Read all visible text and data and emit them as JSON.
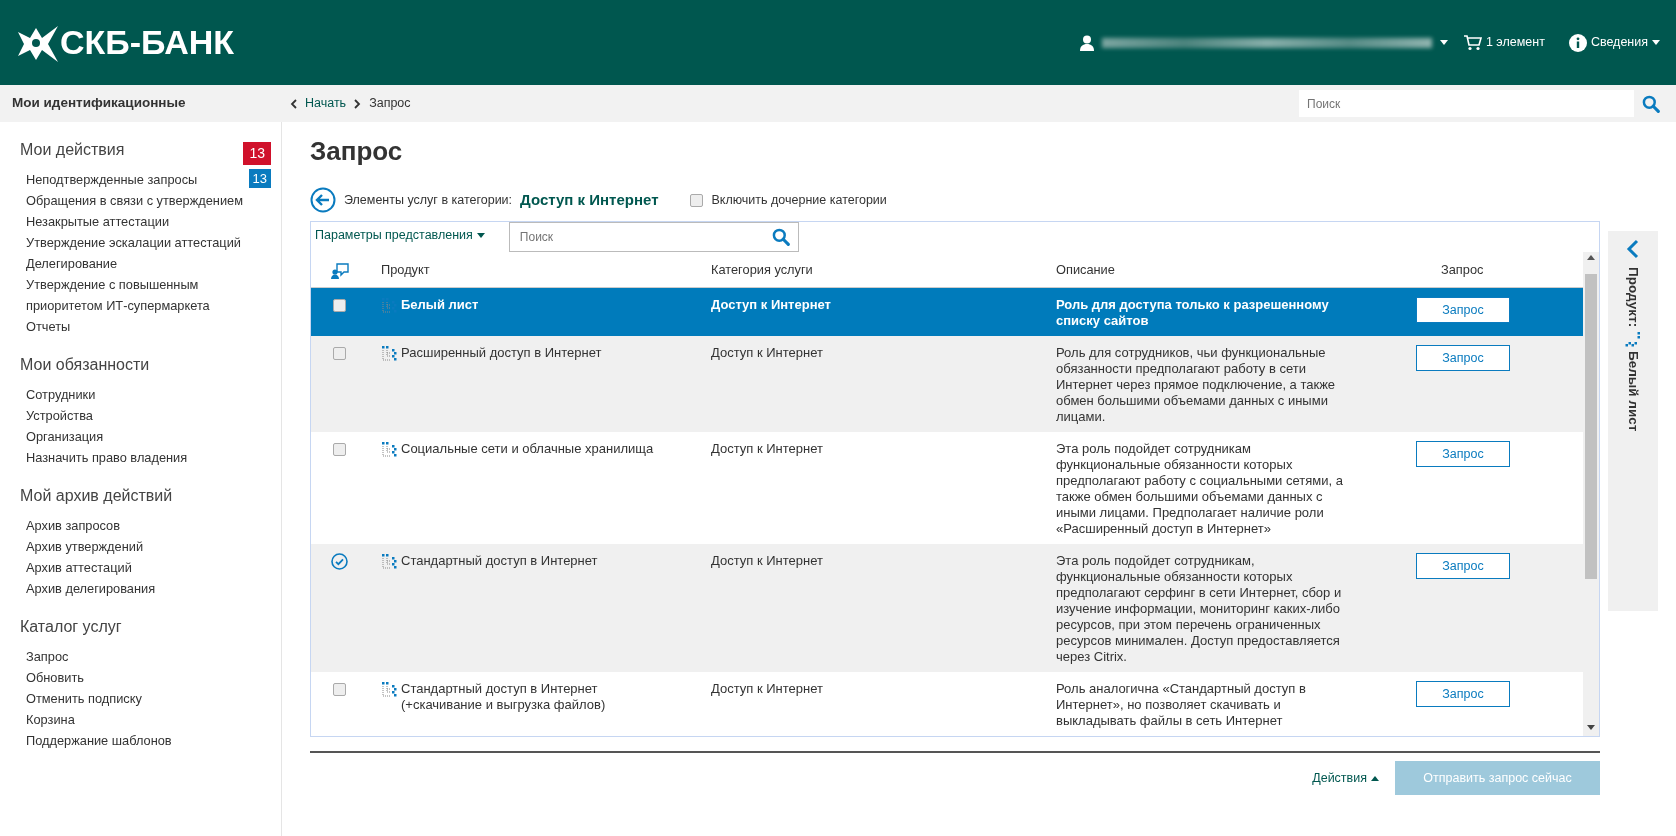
{
  "header": {
    "logo": "СКБ-БАНК",
    "cart": "1 элемент",
    "info_menu": "Сведения"
  },
  "topbar": {
    "section_title": "Мои идентификационные",
    "breadcrumbs": [
      "Начать",
      "Запрос"
    ],
    "search": {
      "placeholder": "Поиск"
    }
  },
  "sidebar": {
    "groups": [
      {
        "title": "Мои действия",
        "badge": "13",
        "items": [
          {
            "label": "Неподтвержденные запросы",
            "badge": "13"
          },
          {
            "label": "Обращения в связи с утверждением"
          },
          {
            "label": "Незакрытые аттестации"
          },
          {
            "label": "Утверждение эскалации аттестаций"
          },
          {
            "label": "Делегирование"
          },
          {
            "label": "Утверждение с повышенным приоритетом ИТ-супермаркета"
          },
          {
            "label": "Отчеты"
          }
        ]
      },
      {
        "title": "Мои обязанности",
        "items": [
          {
            "label": "Сотрудники"
          },
          {
            "label": "Устройства"
          },
          {
            "label": "Организация"
          },
          {
            "label": "Назначить право владения"
          }
        ]
      },
      {
        "title": "Мой архив действий",
        "items": [
          {
            "label": "Архив запросов"
          },
          {
            "label": "Архив утверждений"
          },
          {
            "label": "Архив аттестаций"
          },
          {
            "label": "Архив делегирования"
          }
        ]
      },
      {
        "title": "Каталог услуг",
        "items": [
          {
            "label": "Запрос"
          },
          {
            "label": "Обновить"
          },
          {
            "label": "Отменить подписку"
          },
          {
            "label": "Корзина"
          },
          {
            "label": "Поддержание шаблонов"
          }
        ]
      }
    ]
  },
  "page": {
    "title": "Запрос",
    "category_label": "Элементы услуг в категории:",
    "category": "Доступ к Интернет",
    "include_children": {
      "label": "Включить дочерние категории",
      "checked": false
    }
  },
  "table": {
    "view_options": "Параметры представления",
    "search": {
      "placeholder": "Поиск"
    },
    "columns": [
      "Продукт",
      "Категория услуги",
      "Описание",
      "Запрос"
    ],
    "rows": [
      {
        "kind": "checkbox",
        "checked": false,
        "selected": true,
        "product": "Белый лист",
        "category": "Доступ к Интернет",
        "description": "Роль для доступа только к разрешенному списку сайтов",
        "button": "Запрос"
      },
      {
        "kind": "checkbox",
        "checked": false,
        "selected": false,
        "product": "Расширенный доступ в Интернет",
        "category": "Доступ к Интернет",
        "description": "Роль для сотрудников, чьи функциональные обязанности предполагают работу в сети Интернет через прямое подключение, а также обмен большими объемами данных с иными лицами.",
        "button": "Запрос"
      },
      {
        "kind": "checkbox",
        "checked": false,
        "selected": false,
        "product": "Социальные сети и облачные хранилища",
        "category": "Доступ к Интернет",
        "description": "Эта роль подойдет сотрудникам функциональные обязанности которых предполагают работу с социальными сетями, а также обмен большими объемами данных с иными лицами. Предполагает наличие роли «Расширенный доступ в Интернет»",
        "button": "Запрос"
      },
      {
        "kind": "added",
        "selected": false,
        "product": "Стандартный доступ в Интернет",
        "category": "Доступ к Интернет",
        "description": "Эта роль подойдет сотрудникам, функциональные обязанности которых предполагают серфинг в сети Интернет, сбор и изучение информации, мониторинг каких-либо ресурсов, при этом перечень ограниченных ресурсов минимален. Доступ предоставляется через Citrix.",
        "button": "Запрос"
      },
      {
        "kind": "checkbox",
        "checked": false,
        "selected": false,
        "product": "Стандартный доступ в Интернет\n(+скачивание и выгрузка файлов)",
        "category": "Доступ к Интернет",
        "description": "Роль аналогична «Стандартный доступ в Интернет», но позволяет скачивать и выкладывать файлы в сеть Интернет",
        "button": "Запрос"
      }
    ]
  },
  "details_panel": {
    "label": "Продукт:",
    "value": "Белый лист"
  },
  "footer": {
    "actions": "Действия",
    "submit": {
      "label": "Отправить запрос сейчас",
      "disabled": true
    }
  }
}
